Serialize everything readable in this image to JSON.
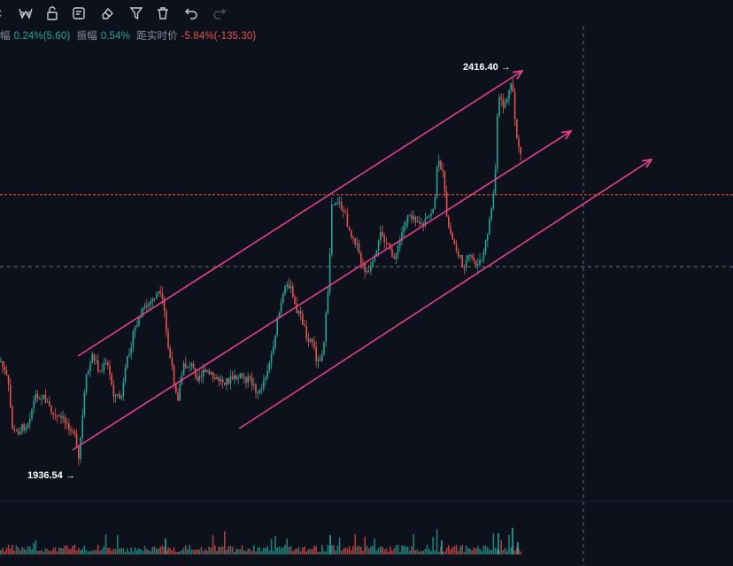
{
  "toolbar": {
    "icons": [
      "more-icon",
      "tag-icon",
      "lock-icon",
      "note-icon",
      "eraser-icon",
      "filter-icon",
      "trash-icon",
      "undo-icon",
      "redo-icon"
    ]
  },
  "stats": {
    "change_label": "幅",
    "change_value": "0.24%(5.60)",
    "amplitude_label": "振幅",
    "amplitude_value": "0.54%",
    "ath_label": "距实时价",
    "ath_value": "-5.84%(-135.30)"
  },
  "colors": {
    "background": "#0d111c",
    "up": "#26a69a",
    "down": "#e5534b",
    "channel": "#e83e8c",
    "price_line": "#c0392b"
  },
  "chart_data": {
    "type": "candlestick",
    "high_label": "2416.40",
    "low_label": "1936.54",
    "high": 2416.4,
    "low": 1936.54,
    "horizontal_level": 2276,
    "channel_lines": "3 parallel ascending pink trend lines forming a channel with arrows"
  }
}
